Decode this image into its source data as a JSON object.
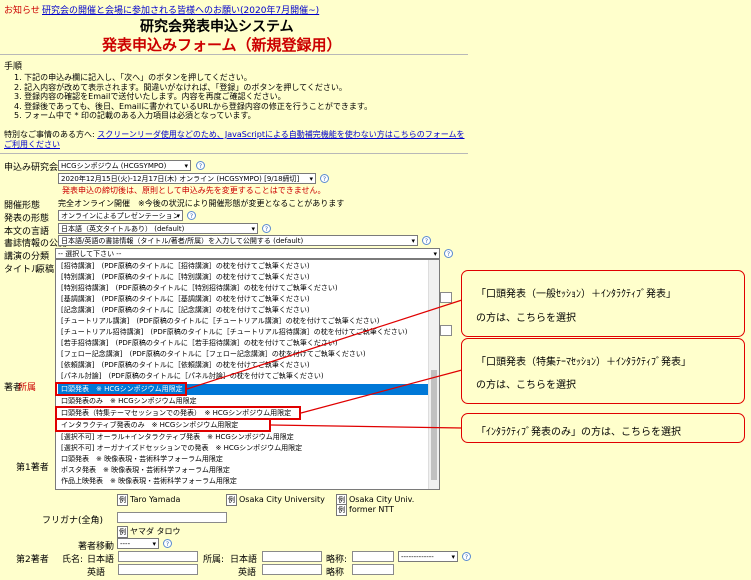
{
  "notice": {
    "label": "お知らせ",
    "link": "研究会の開催と会場に参加される皆様へのお願い(2020年7月開催~)"
  },
  "header": {
    "title": "研究会発表申込システム",
    "subtitle": "発表申込みフォーム（新規登録用）"
  },
  "procedure": {
    "heading": "手順",
    "steps": [
      "1. 下記の申込み欄に記入し、「次へ」のボタンを押してください。",
      "2. 記入内容が改めて表示されます。間違いがなければ、「登録」のボタンを押してください。",
      "3. 登録内容の確認をEmailで送付いたします。内容を再度ご確認ください。",
      "4. 登録後であっても、後日、Emailに書かれているURLから登録内容の修正を行うことができます。",
      "5. フォーム中で * 印の記載のある入力項目は必須となっています。"
    ],
    "special_text": "特別なご事情のある方へ: ",
    "special_link": "スクリーンリーダ使用などのため、JavaScriptによる自動補完機能を使わない方はこちらのフォームをご利用ください"
  },
  "form": {
    "society_label": "申込み研究会",
    "society_value": "HCGシンポジウム (HCGSYMPO)",
    "date_value": "2020年12月15日(火)-12月17日(木) オンライン (HCGSYMPO) [9/18締切]",
    "deadline_note": "発表申込の締切後は、原則として申込み先を変更することはできません。",
    "format_label": "開催形態",
    "format_value": "完全オンライン開催　※今後の状況により開催形態が変更となることがあります",
    "presentation_label": "発表の形態",
    "presentation_value": "オンラインによるプレゼンテーション",
    "lang_label": "本文の言語",
    "lang_value": "日本語（英文タイトルあり） (default)",
    "biblio_label": "書誌情報の公開",
    "biblio_value": "日本語/英語の書誌情報（タイトル/著者/所属）を入力して公開する (default)",
    "category_label": "講演の分類",
    "category_value": "-- 選択して下さい --",
    "title_label": "タイトル",
    "title_sub": "原稿",
    "author_label": "著者",
    "affil_label": "所属",
    "first_author": "第1著者",
    "second_author": "第2著者",
    "example_en": "Taro Yamada",
    "example_affil": "Osaka City University",
    "example_affil2": "Osaka City Univ.",
    "example_former": "former NTT",
    "example_prefix": "例",
    "furigana_label": "フリガナ(全角)",
    "furigana_example": "ヤマダ タロウ",
    "move_label": "著者移動",
    "move_value": "----",
    "name_label": "氏名",
    "japanese": "日本語",
    "english": "英語",
    "affiliation": "所属",
    "abbr": "略称",
    "abbr2": "略称",
    "affil_select": "-------------"
  },
  "dropdown": {
    "options": [
      "[招待講演]　(PDF原稿のタイトルに［招待講演］の枕を付けてご執筆ください)",
      "[特別講演]　(PDF原稿のタイトルに［特別講演］の枕を付けてご執筆ください)",
      "[特別招待講演]　(PDF原稿のタイトルに［特別招待講演］の枕を付けてご執筆ください)",
      "[基調講演]　(PDF原稿のタイトルに［基調講演］の枕を付けてご執筆ください)",
      "[記念講演]　(PDF原稿のタイトルに［記念講演］の枕を付けてご執筆ください)",
      "[チュートリアル講演]　(PDF原稿のタイトルに［チュートリアル講演］の枕を付けてご執筆ください)",
      "[チュートリアル招待講演]　(PDF原稿のタイトルに［チュートリアル招待講演］の枕を付けてご執筆ください)",
      "[若手招待講演]　(PDF原稿のタイトルに［若手招待講演］の枕を付けてご執筆ください)",
      "[フェロー記念講演]　(PDF原稿のタイトルに［フェロー記念講演］の枕を付けてご執筆ください)",
      "[依頼講演]　(PDF原稿のタイトルに［依頼講演］の枕を付けてご執筆ください)",
      "[パネル討論]　(PDF原稿のタイトルに［パネル討論］の枕を付けてご執筆ください)",
      "口頭発表　※ HCGシンポジウム用限定",
      "口頭発表のみ　※ HCGシンポジウム用限定",
      "口頭発表（特集テーマセッションでの発表）　※ HCGシンポジウム用限定",
      "インタラクティブ発表のみ　※ HCGシンポジウム用限定",
      "[選択不可] オーラル+インタラクティブ発表　※ HCGシンポジウム用限定",
      "[選択不可] オーガナイズドセッションでの発表　※ HCGシンポジウム用限定",
      "口頭発表　※ 映像表現・芸術科学フォーラム用限定",
      "ポスタ発表　※ 映像表現・芸術科学フォーラム用限定",
      "作品上映発表　※ 映像表現・芸術科学フォーラム用限定"
    ],
    "selected_index": 11
  },
  "callouts": [
    {
      "line1": "「口頭発表（一般ｾｯｼｮﾝ）＋ｲﾝﾀﾗｸﾃｨﾌﾞ発表」",
      "line2": "の方は、こちらを選択"
    },
    {
      "line1": "「口頭発表（特集ﾃｰﾏｾｯｼｮﾝ）＋ｲﾝﾀﾗｸﾃｨﾌﾞ発表」",
      "line2": "の方は、こちらを選択"
    },
    {
      "line1": "「ｲﾝﾀﾗｸﾃｨﾌﾞ発表のみ」の方は、こちらを選択",
      "line2": ""
    }
  ],
  "colors": {
    "background": "#ffffcc",
    "accent_red": "#cc0000",
    "highlight": "#0078d7",
    "link": "#0000cc"
  }
}
